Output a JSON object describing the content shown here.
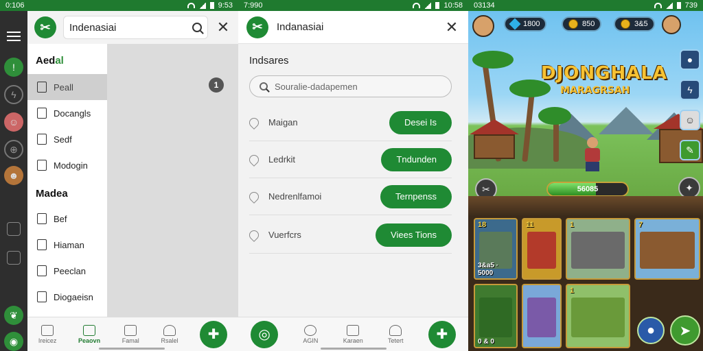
{
  "panel1": {
    "status": {
      "time": "0:106",
      "right": "9:53"
    },
    "search_value": "Indenasiai",
    "drawer": {
      "section1_prefix": "Aed",
      "section1_accent": "al",
      "items1": [
        "Peall",
        "Docangls",
        "Sedf",
        "Modogin"
      ],
      "section2": "Madea",
      "items2": [
        "Bef",
        "Hiaman",
        "Peeclan",
        "Diogaeisn"
      ]
    },
    "badge": "1",
    "bottom_nav": [
      {
        "label": "Ireicez",
        "icon": "home-outline-icon"
      },
      {
        "label": "Peaovn",
        "icon": "home-active-icon"
      },
      {
        "label": "Famal",
        "icon": "phone-icon"
      },
      {
        "label": "Rsalel",
        "icon": "person-icon"
      }
    ],
    "fab_icon": "plus-person-icon"
  },
  "panel2": {
    "status": {
      "time": "7:990",
      "right": "10:58"
    },
    "title": "Indanasiai",
    "heading": "Indsares",
    "search_placeholder": "Souralie-dadapemen",
    "rows": [
      {
        "label": "Maigan",
        "button": "Desei Is"
      },
      {
        "label": "Ledrkit",
        "button": "Tndunden"
      },
      {
        "label": "Nedrenlfamoi",
        "button": "Ternpenss"
      },
      {
        "label": "Vuerfcrs",
        "button": "Viees Tions"
      }
    ],
    "bottom_nav": [
      {
        "label": "",
        "icon": "logo-icon"
      },
      {
        "label": "AGIN",
        "icon": "search-icon"
      },
      {
        "label": "Karaen",
        "icon": "mail-icon"
      },
      {
        "label": "Tetert",
        "icon": "person-icon"
      }
    ]
  },
  "panel3": {
    "status": {
      "time": "03134",
      "right": "739"
    },
    "hud": {
      "gems": "1800",
      "coins": "850",
      "gold": "3&5"
    },
    "title": "DJONGHALA",
    "subtitle": "MARAGRSAH",
    "progress_text": "56085",
    "progress_fraction": 0.6,
    "cards": [
      {
        "level": "18",
        "caption": "3&a5 · 5000"
      },
      {
        "level": "11",
        "caption": ""
      },
      {
        "level": "1",
        "caption": ""
      },
      {
        "level": "7",
        "caption": ""
      },
      {
        "level": "",
        "caption": "0 & 0"
      },
      {
        "level": "",
        "caption": ""
      },
      {
        "level": "1",
        "caption": ""
      }
    ]
  },
  "colors": {
    "brand_green": "#1f8a34",
    "status_green": "#1f7a2f",
    "gold_title": "#f7c233"
  }
}
